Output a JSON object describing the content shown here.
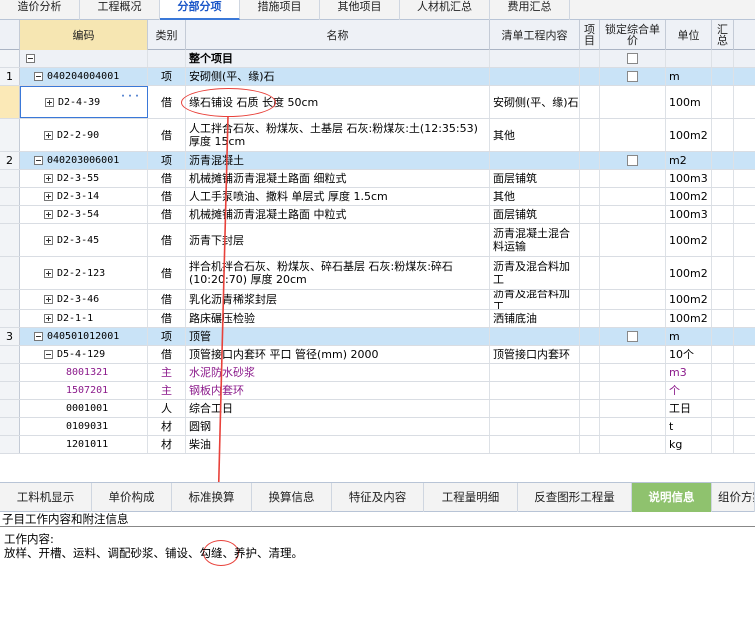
{
  "top_tabs": [
    "造价分析",
    "工程概况",
    "分部分项",
    "措施项目",
    "其他项目",
    "人材机汇总",
    "费用汇总"
  ],
  "active_top_tab": "分部分项",
  "columns": [
    "编码",
    "类别",
    "名称",
    "清单工程内容",
    "项目",
    "锁定综合单价",
    "单位",
    "汇总"
  ],
  "rows": [
    {
      "idx": "",
      "code": "",
      "type": "",
      "name": "整个项目",
      "content": "",
      "unit": "",
      "check": true,
      "style": "header",
      "level": 0,
      "toggle": "minus"
    },
    {
      "idx": "1",
      "code": "040204004001",
      "type": "项",
      "name": "安砌侧(平、缘)石",
      "content": "",
      "unit": "m",
      "check": true,
      "style": "blue",
      "level": 1,
      "toggle": "minus"
    },
    {
      "idx": "",
      "code": "D2-4-39",
      "type": "借",
      "name": "缘石铺设 石质 长度 50cm",
      "content": "安砌侧(平、缘)石",
      "unit": "100m",
      "check": false,
      "style": "selected",
      "level": 2,
      "toggle": "plus"
    },
    {
      "idx": "",
      "code": "D2-2-90",
      "type": "借",
      "name": "人工拌合石灰、粉煤灰、土基层 石灰:粉煤灰:土(12:35:53) 厚度 15cm",
      "content": "其他",
      "unit": "100m2",
      "check": false,
      "style": "normal",
      "level": 2,
      "toggle": "plus"
    },
    {
      "idx": "2",
      "code": "040203006001",
      "type": "项",
      "name": "沥青混凝土",
      "content": "",
      "unit": "m2",
      "check": true,
      "style": "blue",
      "level": 1,
      "toggle": "minus"
    },
    {
      "idx": "",
      "code": "D2-3-55",
      "type": "借",
      "name": "机械摊铺沥青混凝土路面 细粒式",
      "content": "面层铺筑",
      "unit": "100m3",
      "check": false,
      "style": "normal",
      "level": 2,
      "toggle": "plus"
    },
    {
      "idx": "",
      "code": "D2-3-14",
      "type": "借",
      "name": "人工手泵喷油、撒料 单层式 厚度 1.5cm",
      "content": "其他",
      "unit": "100m2",
      "check": false,
      "style": "normal",
      "level": 2,
      "toggle": "plus"
    },
    {
      "idx": "",
      "code": "D2-3-54",
      "type": "借",
      "name": "机械摊铺沥青混凝土路面 中粒式",
      "content": "面层铺筑",
      "unit": "100m3",
      "check": false,
      "style": "normal",
      "level": 2,
      "toggle": "plus"
    },
    {
      "idx": "",
      "code": "D2-3-45",
      "type": "借",
      "name": "沥青下封层",
      "content": "沥青混凝土混合料运输",
      "unit": "100m2",
      "check": false,
      "style": "normal",
      "level": 2,
      "toggle": "plus"
    },
    {
      "idx": "",
      "code": "D2-2-123",
      "type": "借",
      "name": "拌合机拌合石灰、粉煤灰、碎石基层 石灰:粉煤灰:碎石(10:20:70) 厚度 20cm",
      "content": "沥青及混合料加工",
      "unit": "100m2",
      "check": false,
      "style": "normal",
      "level": 2,
      "toggle": "plus"
    },
    {
      "idx": "",
      "code": "D2-3-46",
      "type": "借",
      "name": "乳化沥青稀浆封层",
      "content": "沥青及混合料加工",
      "unit": "100m2",
      "check": false,
      "style": "normal",
      "level": 2,
      "toggle": "plus"
    },
    {
      "idx": "",
      "code": "D2-1-1",
      "type": "借",
      "name": "路床碾压检验",
      "content": "洒铺底油",
      "unit": "100m2",
      "check": false,
      "style": "normal",
      "level": 2,
      "toggle": "plus"
    },
    {
      "idx": "3",
      "code": "040501012001",
      "type": "项",
      "name": "顶管",
      "content": "",
      "unit": "m",
      "check": true,
      "style": "blue",
      "level": 1,
      "toggle": "minus"
    },
    {
      "idx": "",
      "code": "D5-4-129",
      "type": "借",
      "name": "顶管接口内套环 平口 管径(mm) 2000",
      "content": "顶管接口内套环",
      "unit": "10个",
      "check": false,
      "style": "normal",
      "level": 2,
      "toggle": "minus"
    },
    {
      "idx": "",
      "code": "8001321",
      "type": "主",
      "name": "水泥防水砂浆",
      "content": "",
      "unit": "m3",
      "check": false,
      "style": "purple",
      "level": 3,
      "toggle": ""
    },
    {
      "idx": "",
      "code": "1507201",
      "type": "主",
      "name": "钢板内套环",
      "content": "",
      "unit": "个",
      "check": false,
      "style": "purple",
      "level": 3,
      "toggle": ""
    },
    {
      "idx": "",
      "code": "0001001",
      "type": "人",
      "name": "综合工日",
      "content": "",
      "unit": "工日",
      "check": false,
      "style": "normal",
      "level": 3,
      "toggle": ""
    },
    {
      "idx": "",
      "code": "0109031",
      "type": "材",
      "name": "圆钢",
      "content": "",
      "unit": "t",
      "check": false,
      "style": "normal",
      "level": 3,
      "toggle": ""
    },
    {
      "idx": "",
      "code": "1201011",
      "type": "材",
      "name": "柴油",
      "content": "",
      "unit": "kg",
      "check": false,
      "style": "normal",
      "level": 3,
      "toggle": ""
    }
  ],
  "bottom_tabs": [
    "工料机显示",
    "单价构成",
    "标准换算",
    "换算信息",
    "特征及内容",
    "工程量明细",
    "反查图形工程量",
    "说明信息",
    "组价方案"
  ],
  "active_bottom_tab": "说明信息",
  "sub_title": "子目工作内容和附注信息",
  "desc_label": "工作内容:",
  "desc_text": "放样、开槽、运料、调配砂浆、铺设、勾缝、养护、清理。"
}
